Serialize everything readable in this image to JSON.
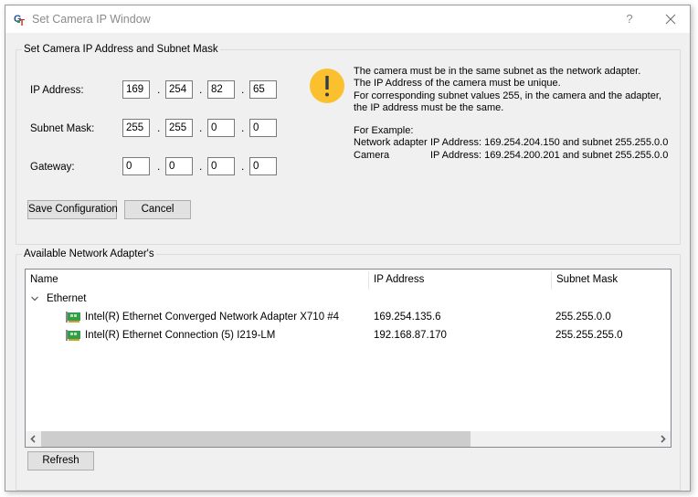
{
  "window": {
    "title": "Set Camera IP Window",
    "help_label": "?",
    "icons": {
      "app": "gt-app-icon",
      "help": "help-icon",
      "close": "close-icon"
    }
  },
  "ip_group": {
    "title": "Set Camera IP Address and Subnet Mask",
    "fields": [
      {
        "label": "IP Address:",
        "octets": [
          "169",
          "254",
          "82",
          "65"
        ]
      },
      {
        "label": "Subnet Mask:",
        "octets": [
          "255",
          "255",
          "0",
          "0"
        ]
      },
      {
        "label": "Gateway:",
        "octets": [
          "0",
          "0",
          "0",
          "0"
        ]
      }
    ],
    "separator": ".",
    "save_label": "Save Configuration",
    "cancel_label": "Cancel",
    "info": {
      "icon": "warning-icon",
      "icon_color": "#fbc02d",
      "lines": [
        "The camera must be in the same subnet as the network adapter.",
        "The IP Address of the camera must be unique.",
        "For corresponding subnet values 255, in the camera and the adapter,",
        "the IP address must be the same."
      ],
      "example_title": "For Example:",
      "examples": [
        {
          "prefix": "Network adapter",
          "text": "IP Address:  169.254.204.150 and subnet 255.255.0.0"
        },
        {
          "prefix": "Camera",
          "text": "IP Address:  169.254.200.201 and subnet 255.255.0.0"
        }
      ]
    }
  },
  "adapters_group": {
    "title": "Available Network Adapter's",
    "columns": [
      "Name",
      "IP Address",
      "Subnet Mask"
    ],
    "categories": [
      {
        "name": "Ethernet",
        "expanded": true,
        "adapters": [
          {
            "name": "Intel(R) Ethernet Converged Network Adapter X710 #4",
            "ip": "169.254.135.6",
            "subnet": "255.255.0.0",
            "icon": "network-card-icon"
          },
          {
            "name": "Intel(R) Ethernet Connection (5) I219-LM",
            "ip": "192.168.87.170",
            "subnet": "255.255.255.0",
            "icon": "network-card-icon"
          }
        ]
      }
    ],
    "horizontal_scroll_fraction": 0.7,
    "refresh_label": "Refresh"
  }
}
